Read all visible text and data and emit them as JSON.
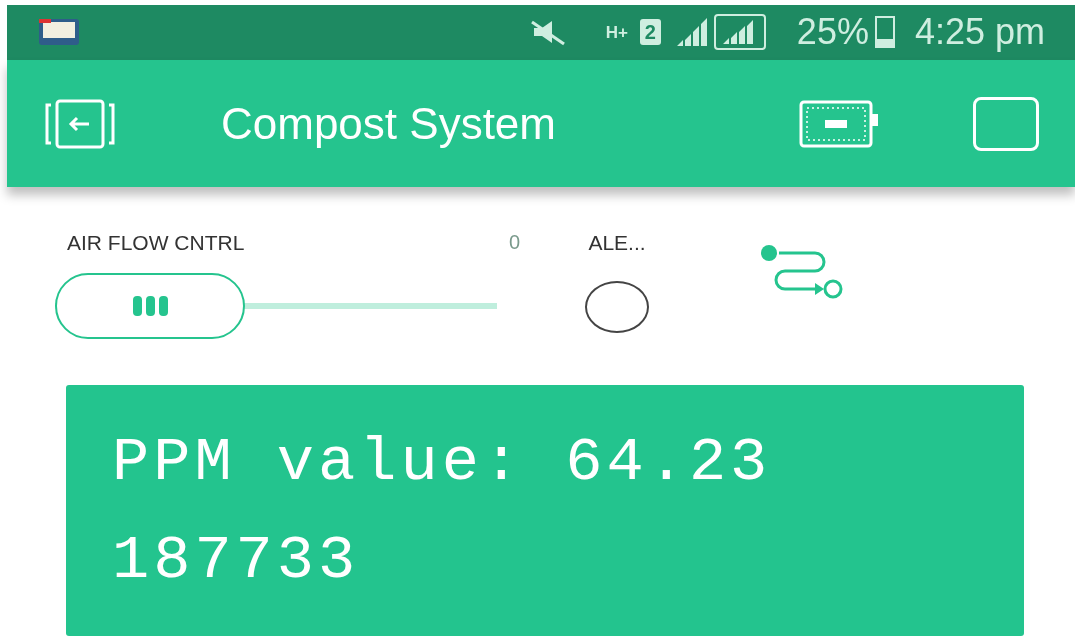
{
  "status_bar": {
    "network": "H+",
    "sim": "2",
    "battery": "25%",
    "time": "4:25 pm"
  },
  "app_bar": {
    "title": "Compost System"
  },
  "slider": {
    "label": "AIR FLOW CNTRL",
    "reading": "0"
  },
  "led": {
    "label": "ALE...",
    "on": false
  },
  "lcd": {
    "lines": [
      "PPM value: 64.23",
      "187733"
    ]
  }
}
